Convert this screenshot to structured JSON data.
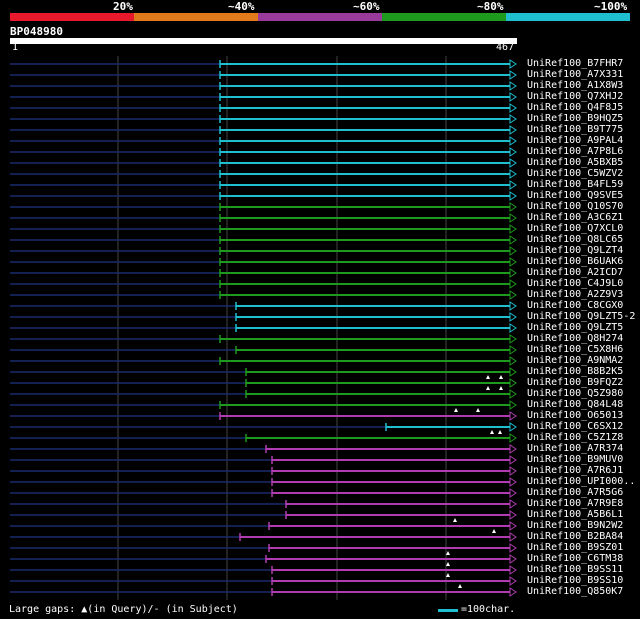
{
  "header": {
    "percent_labels": [
      "20%",
      "~40%",
      "~60%",
      "~80%",
      "~100%"
    ],
    "band_colors": [
      "#e8182d",
      "#e07a1a",
      "#9a3a9a",
      "#1e9a1e",
      "#1fbfcf"
    ],
    "query_name": "BP048980",
    "ruler_start": "1",
    "ruler_end": "467"
  },
  "hits": [
    {
      "name": "UniRef100_B7FHR7",
      "start": 220,
      "color": "cyan",
      "marks": []
    },
    {
      "name": "UniRef100_A7X331",
      "start": 220,
      "color": "cyan",
      "marks": []
    },
    {
      "name": "UniRef100_A1X8W3",
      "start": 220,
      "color": "cyan",
      "marks": []
    },
    {
      "name": "UniRef100_Q7XHJ2",
      "start": 220,
      "color": "cyan",
      "marks": []
    },
    {
      "name": "UniRef100_Q4F8J5",
      "start": 220,
      "color": "cyan",
      "marks": []
    },
    {
      "name": "UniRef100_B9HQZ5",
      "start": 220,
      "color": "cyan",
      "marks": []
    },
    {
      "name": "UniRef100_B9T775",
      "start": 220,
      "color": "cyan",
      "marks": []
    },
    {
      "name": "UniRef100_A9PAL4",
      "start": 220,
      "color": "cyan",
      "marks": []
    },
    {
      "name": "UniRef100_A7P8L6",
      "start": 220,
      "color": "cyan",
      "marks": []
    },
    {
      "name": "UniRef100_A5BXB5",
      "start": 220,
      "color": "cyan",
      "marks": []
    },
    {
      "name": "UniRef100_C5WZV2",
      "start": 220,
      "color": "cyan",
      "marks": []
    },
    {
      "name": "UniRef100_B4FL59",
      "start": 220,
      "color": "cyan",
      "marks": []
    },
    {
      "name": "UniRef100_Q9SVE5",
      "start": 220,
      "color": "cyan",
      "marks": []
    },
    {
      "name": "UniRef100_Q10S70",
      "start": 220,
      "color": "green",
      "marks": []
    },
    {
      "name": "UniRef100_A3C6Z1",
      "start": 220,
      "color": "green",
      "marks": []
    },
    {
      "name": "UniRef100_Q7XCL0",
      "start": 220,
      "color": "green",
      "marks": []
    },
    {
      "name": "UniRef100_Q8LC65",
      "start": 220,
      "color": "green",
      "marks": []
    },
    {
      "name": "UniRef100_Q9LZT4",
      "start": 220,
      "color": "green",
      "marks": []
    },
    {
      "name": "UniRef100_B6UAK6",
      "start": 220,
      "color": "green",
      "marks": []
    },
    {
      "name": "UniRef100_A2ICD7",
      "start": 220,
      "color": "green",
      "marks": []
    },
    {
      "name": "UniRef100_C4J9L0",
      "start": 220,
      "color": "green",
      "marks": []
    },
    {
      "name": "UniRef100_A2Z9V3",
      "start": 220,
      "color": "green",
      "marks": []
    },
    {
      "name": "UniRef100_C8CGX0",
      "start": 236,
      "color": "cyan",
      "marks": []
    },
    {
      "name": "UniRef100_Q9LZT5-2",
      "start": 236,
      "color": "cyan",
      "marks": []
    },
    {
      "name": "UniRef100_Q9LZT5",
      "start": 236,
      "color": "cyan",
      "marks": []
    },
    {
      "name": "UniRef100_Q8H274",
      "start": 220,
      "color": "green",
      "marks": []
    },
    {
      "name": "UniRef100_C5X8H6",
      "start": 236,
      "color": "green",
      "marks": []
    },
    {
      "name": "UniRef100_A9NMA2",
      "start": 220,
      "color": "green",
      "marks": []
    },
    {
      "name": "UniRef100_B8B2K5",
      "start": 246,
      "color": "green",
      "marks": []
    },
    {
      "name": "UniRef100_B9FQZ2",
      "start": 246,
      "color": "green",
      "marks": [
        488,
        501
      ]
    },
    {
      "name": "UniRef100_Q5Z980",
      "start": 246,
      "color": "green",
      "marks": [
        488,
        501
      ]
    },
    {
      "name": "UniRef100_Q84L48",
      "start": 220,
      "color": "green",
      "marks": []
    },
    {
      "name": "UniRef100_O65013",
      "start": 220,
      "color": "purple",
      "marks": [
        456,
        478
      ]
    },
    {
      "name": "UniRef100_C6SX12",
      "start": 386,
      "color": "cyan",
      "marks": []
    },
    {
      "name": "UniRef100_C5Z1Z8",
      "start": 246,
      "color": "green",
      "marks": [
        492,
        500
      ]
    },
    {
      "name": "UniRef100_A7R374",
      "start": 266,
      "color": "purple",
      "marks": []
    },
    {
      "name": "UniRef100_B9MUV0",
      "start": 272,
      "color": "purple",
      "marks": []
    },
    {
      "name": "UniRef100_A7R6J1",
      "start": 272,
      "color": "purple",
      "marks": []
    },
    {
      "name": "UniRef100_UPI000..",
      "start": 272,
      "color": "purple",
      "marks": []
    },
    {
      "name": "UniRef100_A7R5G6",
      "start": 272,
      "color": "purple",
      "marks": []
    },
    {
      "name": "UniRef100_A7R9E8",
      "start": 286,
      "color": "purple",
      "marks": []
    },
    {
      "name": "UniRef100_A5B6L1",
      "start": 286,
      "color": "purple",
      "marks": []
    },
    {
      "name": "UniRef100_B9N2W2",
      "start": 269,
      "color": "purple",
      "marks": [
        455
      ]
    },
    {
      "name": "UniRef100_B2BA84",
      "start": 240,
      "color": "purple",
      "marks": [
        494
      ]
    },
    {
      "name": "UniRef100_B9SZ01",
      "start": 269,
      "color": "purple",
      "marks": []
    },
    {
      "name": "UniRef100_C6TM38",
      "start": 266,
      "color": "purple",
      "marks": [
        448
      ]
    },
    {
      "name": "UniRef100_B9SS11",
      "start": 272,
      "color": "purple",
      "marks": [
        448
      ]
    },
    {
      "name": "UniRef100_B9SS10",
      "start": 272,
      "color": "purple",
      "marks": [
        448
      ]
    },
    {
      "name": "UniRef100_Q850K7",
      "start": 272,
      "color": "purple",
      "marks": [
        460
      ]
    }
  ],
  "footer": {
    "gaps_text": "Large gaps:",
    "in_query": "(in Query)/",
    "dash": "-",
    "in_subject": " (in Subject)",
    "legend_text": "=100char."
  },
  "colors": {
    "cyan": "#1fbfcf",
    "green": "#1e9a1e",
    "purple": "#b03cb0",
    "navy": "#1a2a6e",
    "grid": "#444"
  }
}
